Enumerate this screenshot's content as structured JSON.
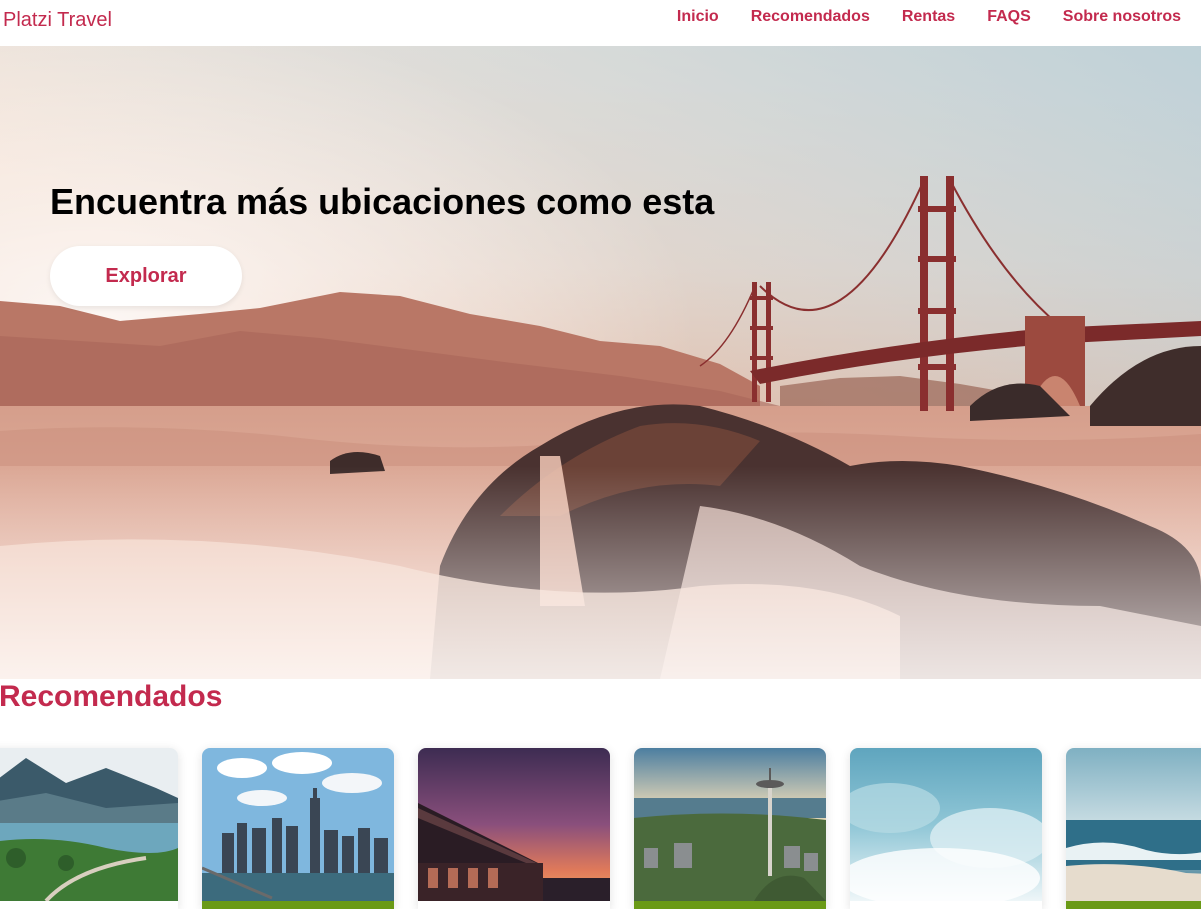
{
  "header": {
    "logo": "Platzi Travel",
    "nav": [
      {
        "label": "Inicio"
      },
      {
        "label": "Recomendados"
      },
      {
        "label": "Rentas"
      },
      {
        "label": "FAQS"
      },
      {
        "label": "Sobre nosotros"
      }
    ]
  },
  "hero": {
    "title": "Encuentra más ubicaciones como esta",
    "button_label": "Explorar"
  },
  "recommended": {
    "title": "Recomendados",
    "cards": [
      {
        "scene": "lake-mountains",
        "bar": "none"
      },
      {
        "scene": "city-skyline",
        "bar": "green"
      },
      {
        "scene": "sunset-building",
        "bar": "none"
      },
      {
        "scene": "space-needle",
        "bar": "green"
      },
      {
        "scene": "clouds-sky",
        "bar": "none"
      },
      {
        "scene": "beach-waves",
        "bar": "green"
      }
    ]
  },
  "colors": {
    "brand": "#c32a4e",
    "card_bar_green": "#6a9a16"
  }
}
